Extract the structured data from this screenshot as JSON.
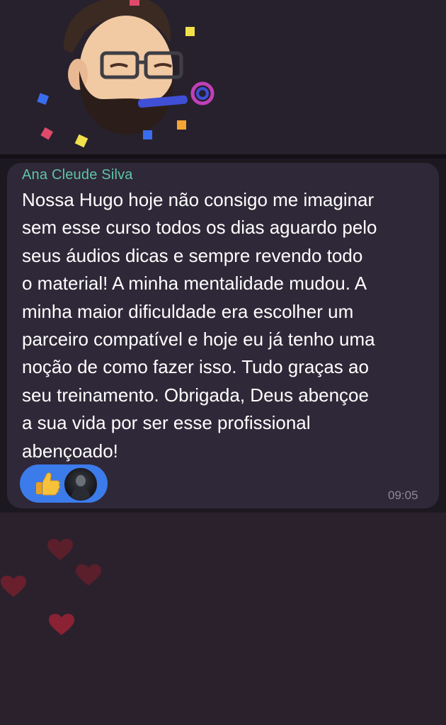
{
  "message": {
    "sender": "Ana Cleude Silva",
    "lines": [
      "Nossa Hugo hoje não consigo me imaginar",
      "sem esse curso todos os dias aguardo pelo",
      "seus áudios dicas e sempre revendo todo",
      "o material! A minha mentalidade mudou. A",
      "minha maior dificuldade era escolher um",
      "parceiro compatível e hoje eu já tenho uma",
      "noção de como fazer isso. Tudo graças ao",
      "seu treinamento. Obrigada, Deus abençoe",
      "a sua vida por ser esse profissional",
      "abençoado!"
    ],
    "time": "09:05",
    "reaction": {
      "emoji": "👍",
      "icon": "thumbs-up-icon"
    }
  },
  "sticker": {
    "description_icon": "party-memoji-sticker"
  },
  "colors": {
    "sender_name": "#5fc4a7",
    "bubble": "#2f2838",
    "reaction_pill": "#3c7bea",
    "heart": "#c0283e"
  }
}
